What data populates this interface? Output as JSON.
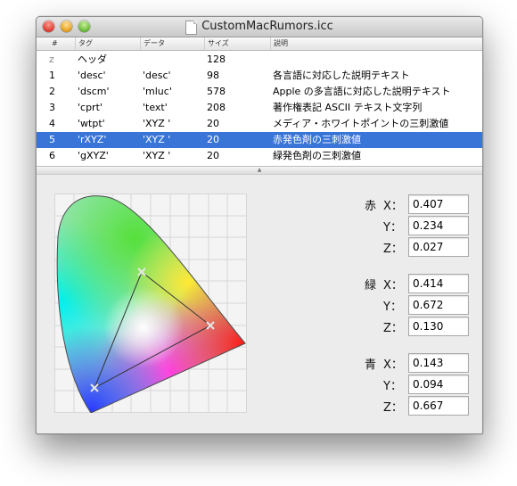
{
  "window": {
    "title": "CustomMacRumors.icc"
  },
  "table": {
    "headers": [
      "#",
      "タグ",
      "データ",
      "サイズ",
      "説明"
    ],
    "rows": [
      {
        "num": "z",
        "tag": "ヘッダ",
        "data": "",
        "size": "128",
        "desc": ""
      },
      {
        "num": "1",
        "tag": "'desc'",
        "data": "'desc'",
        "size": "98",
        "desc": "各言語に対応した説明テキスト"
      },
      {
        "num": "2",
        "tag": "'dscm'",
        "data": "'mluc'",
        "size": "578",
        "desc": "Apple の多言語に対応した説明テキスト"
      },
      {
        "num": "3",
        "tag": "'cprt'",
        "data": "'text'",
        "size": "208",
        "desc": "著作権表記 ASCII テキスト文字列"
      },
      {
        "num": "4",
        "tag": "'wtpt'",
        "data": "'XYZ '",
        "size": "20",
        "desc": "メディア・ホワイトポイントの三刺激値"
      },
      {
        "num": "5",
        "tag": "'rXYZ'",
        "data": "'XYZ '",
        "size": "20",
        "desc": "赤発色剤の三刺激値"
      },
      {
        "num": "6",
        "tag": "'gXYZ'",
        "data": "'XYZ '",
        "size": "20",
        "desc": "緑発色剤の三刺激値"
      }
    ],
    "selected_index": 5
  },
  "tristimulus": {
    "red": {
      "name": "赤",
      "x_label": "X：",
      "y_label": "Y：",
      "z_label": "Z：",
      "x": "0.407",
      "y": "0.234",
      "z": "0.027"
    },
    "green": {
      "name": "緑",
      "x_label": "X：",
      "y_label": "Y：",
      "z_label": "Z：",
      "x": "0.414",
      "y": "0.672",
      "z": "0.130"
    },
    "blue": {
      "name": "青",
      "x_label": "X：",
      "y_label": "Y：",
      "z_label": "Z：",
      "x": "0.143",
      "y": "0.094",
      "z": "0.667"
    }
  },
  "gamut": {
    "primaries_xy": {
      "red": [
        0.64,
        0.33
      ],
      "green": [
        0.3,
        0.6
      ],
      "blue": [
        0.15,
        0.06
      ]
    }
  },
  "colors": {
    "selection": "#3875d7"
  }
}
